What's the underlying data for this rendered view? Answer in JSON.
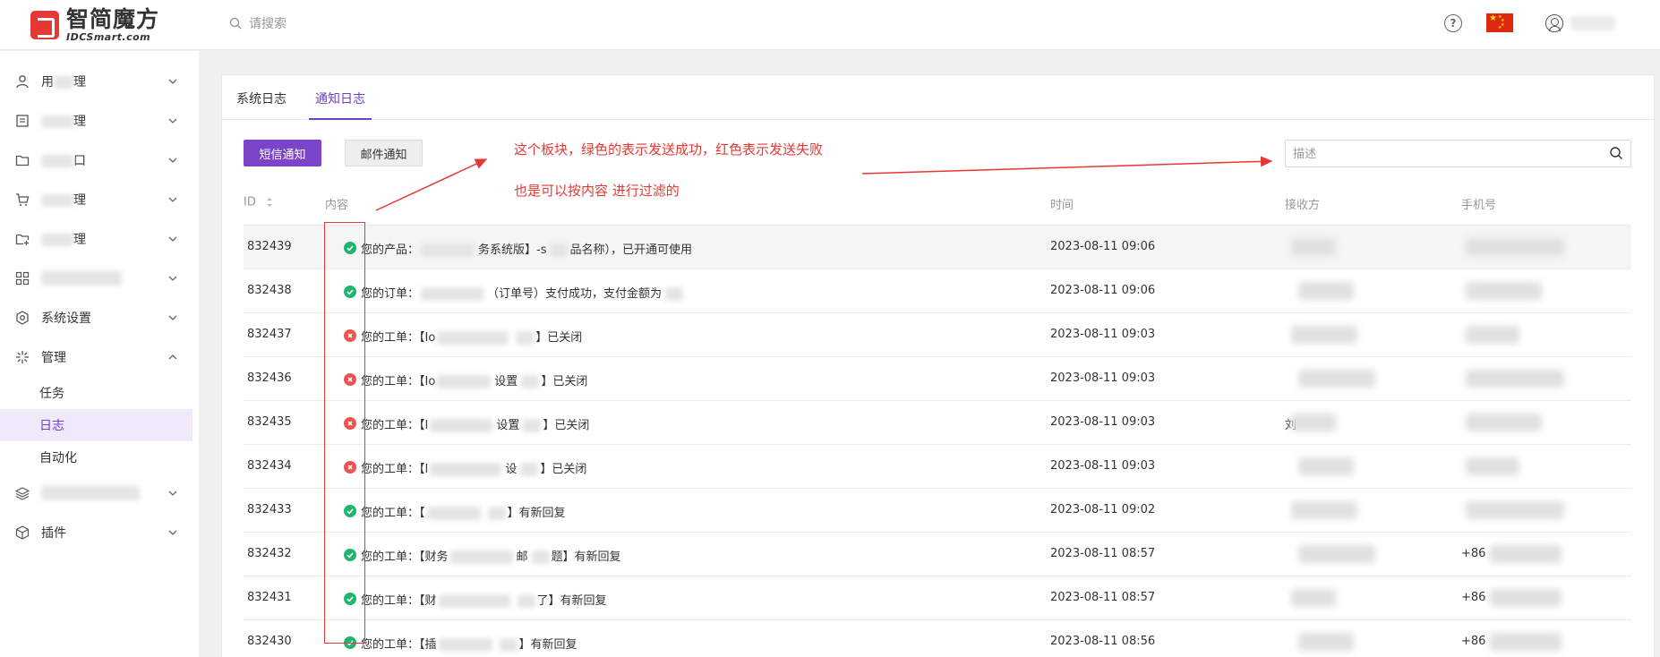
{
  "header": {
    "logo_cn": "智简魔方",
    "logo_en": "IDCSmart.com",
    "search_placeholder": "请搜索"
  },
  "sidebar": {
    "items": [
      {
        "label": "用户管理",
        "visible": "用",
        "visible_tail": "理",
        "icon": "user-icon"
      },
      {
        "label": "业务管理",
        "visible_tail": "理",
        "icon": "list-icon"
      },
      {
        "label": "财务窗口",
        "visible_tail": "口",
        "icon": "folder-icon"
      },
      {
        "label": "商品管理",
        "visible_tail": "理",
        "icon": "cart-icon"
      },
      {
        "label": "资源管理",
        "visible_tail": "理",
        "icon": "folder-add-icon"
      },
      {
        "label": "应用中心",
        "icon": "grid-icon"
      },
      {
        "label": "系统设置",
        "icon": "settings-icon"
      },
      {
        "label": "管理",
        "icon": "sparkle-icon",
        "expanded": true
      }
    ],
    "sub_items": [
      "任务",
      "日志",
      "自动化"
    ],
    "active_sub": "日志",
    "bottom_items": [
      {
        "label": "",
        "icon": "layers-icon"
      },
      {
        "label": "插件",
        "icon": "cube-icon"
      }
    ]
  },
  "tabs": [
    "系统日志",
    "通知日志"
  ],
  "active_tab": "通知日志",
  "buttons": {
    "sms": "短信通知",
    "email": "邮件通知"
  },
  "search": {
    "placeholder": "描述"
  },
  "annotations": {
    "line1": "这个板块，绿色的表示发送成功，红色表示发送失败",
    "line2": "也是可以按内容 进行过滤的",
    "annotation_color": "#e53935"
  },
  "table": {
    "columns": [
      "ID",
      "内容",
      "时间",
      "接收方",
      "手机号"
    ],
    "rows": [
      {
        "id": "832439",
        "status": "success",
        "content_a": "您的产品：",
        "content_b": "务系统版】-s",
        "content_c": "品名称），已开通可使用",
        "time": "2023-08-11 09:06",
        "receiver": "",
        "phone": ""
      },
      {
        "id": "832438",
        "status": "success",
        "content_a": "您的订单：",
        "content_b": "（订单号）支付成功，支付金额为",
        "content_c": "",
        "time": "2023-08-11 09:06",
        "receiver": "",
        "phone": ""
      },
      {
        "id": "832437",
        "status": "fail",
        "content_a": "您的工单：【Io",
        "content_b": "",
        "content_c": "】已关闭",
        "time": "2023-08-11 09:03",
        "receiver": "",
        "phone": ""
      },
      {
        "id": "832436",
        "status": "fail",
        "content_a": "您的工单：【Io",
        "content_b": "设置",
        "content_c": "】已关闭",
        "time": "2023-08-11 09:03",
        "receiver": "",
        "phone": ""
      },
      {
        "id": "832435",
        "status": "fail",
        "content_a": "您的工单：【I",
        "content_b": "设置",
        "content_c": "】已关闭",
        "time": "2023-08-11 09:03",
        "receiver": "刘",
        "phone": ""
      },
      {
        "id": "832434",
        "status": "fail",
        "content_a": "您的工单：【I",
        "content_b": "设",
        "content_c": "】已关闭",
        "time": "2023-08-11 09:03",
        "receiver": "",
        "phone": ""
      },
      {
        "id": "832433",
        "status": "success",
        "content_a": "您的工单：【",
        "content_b": "",
        "content_c": "】有新回复",
        "time": "2023-08-11 09:02",
        "receiver": "",
        "phone": ""
      },
      {
        "id": "832432",
        "status": "success",
        "content_a": "您的工单：【财务",
        "content_b": "邮",
        "content_c": "题】有新回复",
        "time": "2023-08-11 08:57",
        "receiver": "",
        "phone": "+86"
      },
      {
        "id": "832431",
        "status": "success",
        "content_a": "您的工单：【财",
        "content_b": "",
        "content_c": "了】有新回复",
        "time": "2023-08-11 08:57",
        "receiver": "",
        "phone": "+86"
      },
      {
        "id": "832430",
        "status": "success",
        "content_a": "您的工单：【插",
        "content_b": "",
        "content_c": "】有新回复",
        "time": "2023-08-11 08:56",
        "receiver": "",
        "phone": "+86"
      }
    ]
  },
  "colors": {
    "accent": "#6f42c1",
    "primary_button": "#7b44c9",
    "success": "#1fb56d",
    "fail": "#ef5350"
  }
}
